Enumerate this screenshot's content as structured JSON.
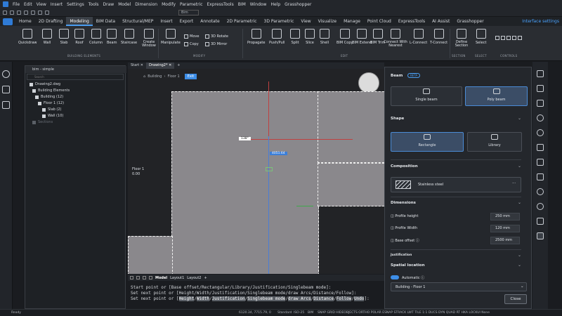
{
  "menubar": {
    "items": [
      "File",
      "Edit",
      "View",
      "Insert",
      "Settings",
      "Tools",
      "Draw",
      "Model",
      "Dimension",
      "Modify",
      "Parametric",
      "ExpressTools",
      "BIM",
      "Window",
      "Help",
      "Grasshopper"
    ]
  },
  "qat": {
    "workspace": "Bim"
  },
  "tabs": {
    "items": [
      "Home",
      "2D Drafting",
      "Modeling",
      "BIM Data",
      "Structural/MEP",
      "Insert",
      "Export",
      "Annotate",
      "2D Parametric",
      "3D Parametric",
      "View",
      "Visualize",
      "Manage",
      "Point Cloud",
      "ExpressTools",
      "AI Assist",
      "Grasshopper"
    ],
    "active": "Modeling",
    "interface_settings": "Interface settings"
  },
  "ribbon": {
    "big": [
      "Quickdraw",
      "Wall",
      "Slab",
      "Roof",
      "Column",
      "Beam",
      "Staircase",
      "Create Window",
      "Manipulate",
      "Propagate",
      "Push/Pull",
      "Split",
      "Slice",
      "Shell",
      "BIM Copy",
      "BIM Extend",
      "BIM Trim",
      "Connect With Nearest",
      "L-Connect",
      "T-Connect",
      "Define Section",
      "Select"
    ],
    "small": {
      "move": "Move",
      "rotate3d": "3D Rotate",
      "copy": "Copy",
      "mirror3d": "3D Mirror"
    },
    "groups": {
      "building": "BUILDING ELEMENTS",
      "modify": "MODIFY",
      "edit": "EDIT",
      "section": "SECTION",
      "select": "SELECT",
      "controls": "CONTROLS"
    }
  },
  "tree": {
    "title": "bim - simple",
    "search": "Search",
    "rows": [
      "Drawing2.dwg",
      "Building Elements",
      "Building (12)",
      "Floor 1 (12)",
      "Slab (2)",
      "Wall (10)",
      "Sections"
    ]
  },
  "doctabs": {
    "items": [
      "Start",
      "Drawing2*"
    ]
  },
  "viewport": {
    "breadcrumb_building": "Building",
    "breadcrumb_floor": "Floor 1",
    "exit": "Exit",
    "angle": "138°",
    "length": "4051.64",
    "floor_label": "Floor 1",
    "floor_elev": "0.00"
  },
  "layouttabs": {
    "items": [
      "Model",
      "Layout1",
      "Layout2"
    ]
  },
  "cmd": {
    "line1": "Start point or [Base offset/Rectangular/Library/Justification/Singlebeam mode]:",
    "line2": "Set next point or [Height/Width/Justification/Singlebeam mode/draw Arcs/Distance/Follow]:",
    "line3_prefix": "Set next point or [",
    "line3_opts": [
      "Height",
      "Width",
      "Justification",
      "Singlebeam mode",
      "draw Arcs",
      "Distance",
      "Follow",
      "Undo"
    ],
    "line3_suffix": "]:"
  },
  "panel": {
    "title": "Beam",
    "badge": "BETA",
    "single": "Single beam",
    "poly": "Poly beam",
    "shape": "Shape",
    "rectangle": "Rectangle",
    "library": "Library",
    "composition": "Composition",
    "material": "Stainless steel",
    "dimensions": "Dimensions",
    "profile_height_label": "Profile height",
    "profile_height": "250 mm",
    "profile_width_label": "Profile Width",
    "profile_width": "120 mm",
    "base_offset_label": "Base offset",
    "base_offset": "2500 mm",
    "justification": "Justification",
    "spatial": "Spatial location",
    "automatic": "Automatic",
    "floor": "Building - Floor 1",
    "close": "Close"
  },
  "status": {
    "ready": "Ready",
    "coords": "6120.34, 7715.79, 0",
    "style": "Standard",
    "iso": "ISO-25",
    "space": "BIM",
    "toggles": "SNAP GRID HIDEOBJECTS ORTHO POLAR ESNAP STRACK LWT TILE 1:1 DUCS DYN QUAD RT HKA LOCKUI None"
  },
  "colors": {
    "accent": "#4a9df0",
    "slab": "#8a888c",
    "selection": "#3b4d66"
  }
}
